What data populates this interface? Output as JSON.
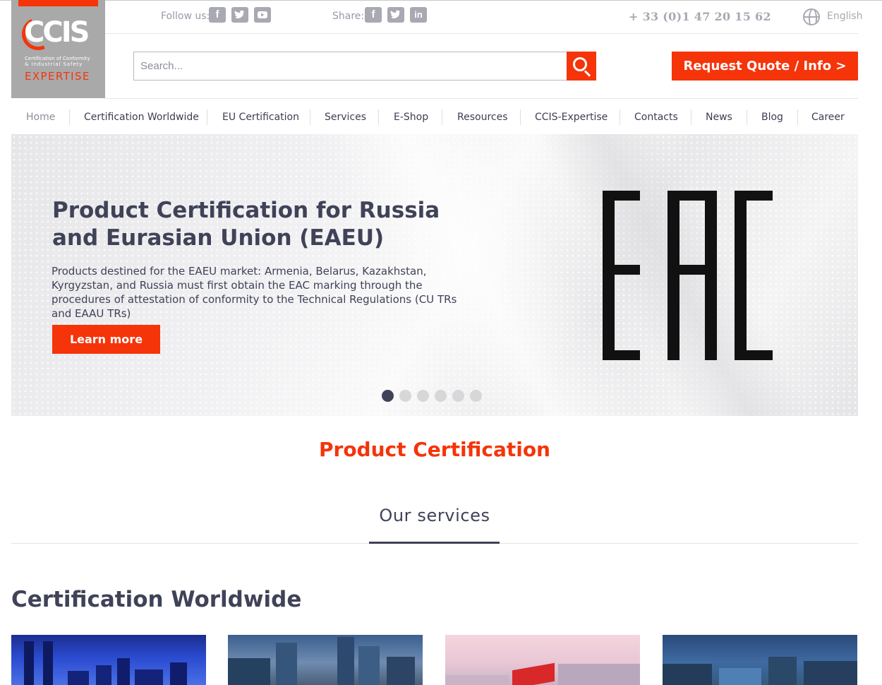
{
  "logo": {
    "word": "CCIS",
    "subtitle_line1": "Certification of Conformity",
    "subtitle_line2": "& Industrial Safety",
    "expertise": "EXPERTISE"
  },
  "topbar": {
    "follow_label": "Follow us:",
    "share_label": "Share:",
    "follow_icons": [
      "facebook-icon",
      "twitter-icon",
      "youtube-icon"
    ],
    "share_icons": [
      "facebook-icon",
      "twitter-icon",
      "linkedin-icon"
    ],
    "phone": "+ 33 (0)1 47 20 15 62",
    "language": "English"
  },
  "search": {
    "placeholder": "Search...",
    "value": ""
  },
  "quote_button": "Request Quote / Info >",
  "nav": [
    "Home",
    "Certification Worldwide",
    "EU Certification",
    "Services",
    "E-Shop",
    "Resources",
    "CCIS-Expertise",
    "Contacts",
    "News",
    "Blog",
    "Career"
  ],
  "hero": {
    "title": "Product Certification for Russia and Eurasian Union (EAEU)",
    "description": "Products destined for the EAEU market: Armenia, Belarus, Kazakhstan, Kyrgyzstan, and Russia must first obtain the EAC marking through the procedures of attestation of conformity to the Technical Regulations (CU TRs and EAAU TRs)",
    "button": "Learn more",
    "mark": "EAC",
    "slide_count": 6,
    "active_slide": 1
  },
  "sections": {
    "product_certification": "Product Certification",
    "our_services": "Our services",
    "certification_worldwide": "Certification Worldwide"
  },
  "colors": {
    "accent": "#f5340a",
    "text": "#404258",
    "muted": "#a8a9b3"
  }
}
